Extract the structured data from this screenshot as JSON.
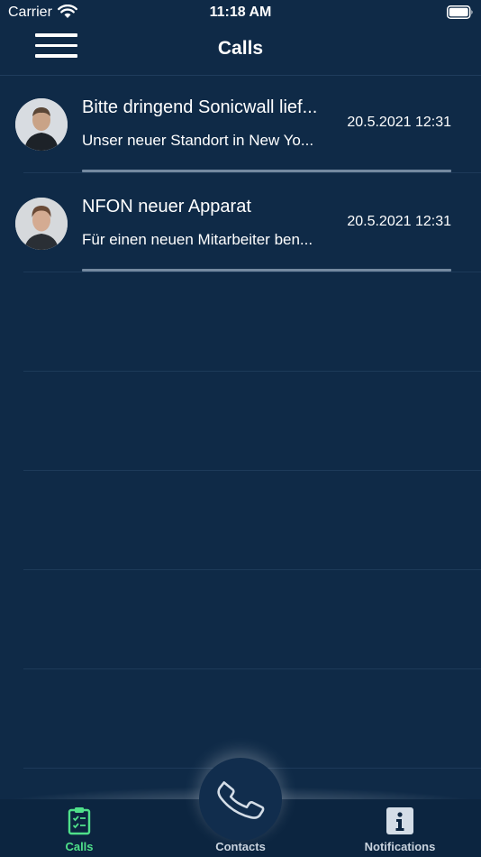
{
  "status_bar": {
    "carrier": "Carrier",
    "time": "11:18 AM"
  },
  "nav": {
    "title": "Calls"
  },
  "calls": [
    {
      "title": "Bitte dringend Sonicwall lief...",
      "subtitle": "Unser neuer Standort in New Yo...",
      "date": "20.5.2021 12:31",
      "avatar": "avatar-person-1"
    },
    {
      "title": "NFON neuer Apparat",
      "subtitle": "Für einen neuen Mitarbeiter ben...",
      "date": "20.5.2021 12:31",
      "avatar": "avatar-person-2"
    }
  ],
  "tabs": [
    {
      "label": "Calls",
      "icon": "clipboard-checklist-icon",
      "active": true
    },
    {
      "label": "Contacts",
      "icon": "phone-icon",
      "active": false
    },
    {
      "label": "Notifications",
      "icon": "info-icon",
      "active": false
    }
  ],
  "colors": {
    "background": "#0f2a47",
    "active_tab": "#4fe08a",
    "divider": "#1d3a59"
  }
}
